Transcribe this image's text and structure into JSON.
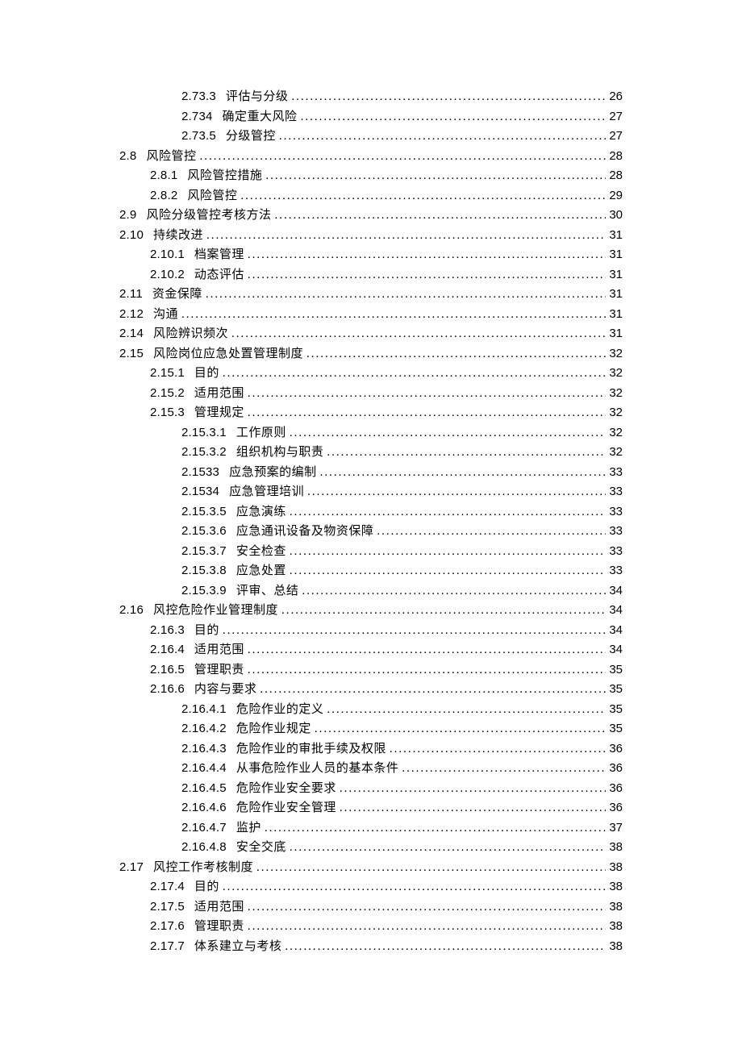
{
  "toc": [
    {
      "level": 3,
      "num": "2.73.3",
      "title": "评估与分级",
      "page": "26"
    },
    {
      "level": 3,
      "num": "2.734",
      "title": "确定重大风险",
      "page": "27"
    },
    {
      "level": 3,
      "num": "2.73.5",
      "title": "分级管控",
      "page": "27"
    },
    {
      "level": 1,
      "num": "2.8",
      "title": "风险管控",
      "page": "28"
    },
    {
      "level": 2,
      "num": "2.8.1",
      "title": "风险管控措施",
      "page": "28"
    },
    {
      "level": 2,
      "num": "2.8.2",
      "title": "风险管控",
      "page": "29"
    },
    {
      "level": 1,
      "num": "2.9",
      "title": "风险分级管控考核方法",
      "page": "30"
    },
    {
      "level": 1,
      "num": "2.10",
      "title": "持续改进",
      "page": "31"
    },
    {
      "level": 2,
      "num": "2.10.1",
      "title": "档案管理",
      "page": "31"
    },
    {
      "level": 2,
      "num": "2.10.2",
      "title": "动态评估",
      "page": "31"
    },
    {
      "level": 1,
      "num": "2.11",
      "title": "资金保障",
      "page": "31"
    },
    {
      "level": 1,
      "num": "2.12",
      "title": "沟通",
      "page": "31"
    },
    {
      "level": 1,
      "num": "2.14",
      "title": "风险辨识频次",
      "page": "31"
    },
    {
      "level": 1,
      "num": "2.15",
      "title": "风险岗位应急处置管理制度",
      "page": "32"
    },
    {
      "level": 2,
      "num": "2.15.1",
      "title": "目的",
      "page": "32"
    },
    {
      "level": 2,
      "num": "2.15.2",
      "title": "适用范围",
      "page": "32"
    },
    {
      "level": 2,
      "num": "2.15.3",
      "title": "管理规定",
      "page": "32"
    },
    {
      "level": 3,
      "num": "2.15.3.1",
      "title": "工作原则",
      "page": "32"
    },
    {
      "level": 3,
      "num": "2.15.3.2",
      "title": "组织机构与职责",
      "page": "32"
    },
    {
      "level": 3,
      "num": "2.1533",
      "title": "应急预案的编制",
      "page": "33"
    },
    {
      "level": 3,
      "num": "2.1534",
      "title": "应急管理培训",
      "page": "33"
    },
    {
      "level": 3,
      "num": "2.15.3.5",
      "title": "应急演练",
      "page": "33"
    },
    {
      "level": 3,
      "num": "2.15.3.6",
      "title": "应急通讯设备及物资保障",
      "page": "33"
    },
    {
      "level": 3,
      "num": "2.15.3.7",
      "title": "安全检查",
      "page": "33"
    },
    {
      "level": 3,
      "num": "2.15.3.8",
      "title": "应急处置",
      "page": "33"
    },
    {
      "level": 3,
      "num": "2.15.3.9",
      "title": "评审、总结",
      "page": "34"
    },
    {
      "level": 1,
      "num": "2.16",
      "title": "风控危险作业管理制度",
      "page": "34"
    },
    {
      "level": 2,
      "num": "2.16.3",
      "title": "目的",
      "page": "34"
    },
    {
      "level": 2,
      "num": "2.16.4",
      "title": "适用范围",
      "page": "34"
    },
    {
      "level": 2,
      "num": "2.16.5",
      "title": "管理职责",
      "page": "35"
    },
    {
      "level": 2,
      "num": "2.16.6",
      "title": "内容与要求",
      "page": "35"
    },
    {
      "level": 3,
      "num": "2.16.4.1",
      "title": "危险作业的定义",
      "page": "35"
    },
    {
      "level": 3,
      "num": "2.16.4.2",
      "title": "危险作业规定",
      "page": "35"
    },
    {
      "level": 3,
      "num": "2.16.4.3",
      "title": "危险作业的审批手续及权限",
      "page": "36"
    },
    {
      "level": 3,
      "num": "2.16.4.4",
      "title": "从事危险作业人员的基本条件",
      "page": "36"
    },
    {
      "level": 3,
      "num": "2.16.4.5",
      "title": "危险作业安全要求",
      "page": "36"
    },
    {
      "level": 3,
      "num": "2.16.4.6",
      "title": "危险作业安全管理",
      "page": "36"
    },
    {
      "level": 3,
      "num": "2.16.4.7",
      "title": "监护",
      "page": "37"
    },
    {
      "level": 3,
      "num": "2.16.4.8",
      "title": "安全交底",
      "page": "38"
    },
    {
      "level": 1,
      "num": "2.17",
      "title": "风控工作考核制度",
      "page": "38"
    },
    {
      "level": 2,
      "num": "2.17.4",
      "title": "目的",
      "page": "38"
    },
    {
      "level": 2,
      "num": "2.17.5",
      "title": "适用范围",
      "page": "38"
    },
    {
      "level": 2,
      "num": "2.17.6",
      "title": "管理职责",
      "page": "38"
    },
    {
      "level": 2,
      "num": "2.17.7",
      "title": "体系建立与考核",
      "page": "38"
    }
  ]
}
